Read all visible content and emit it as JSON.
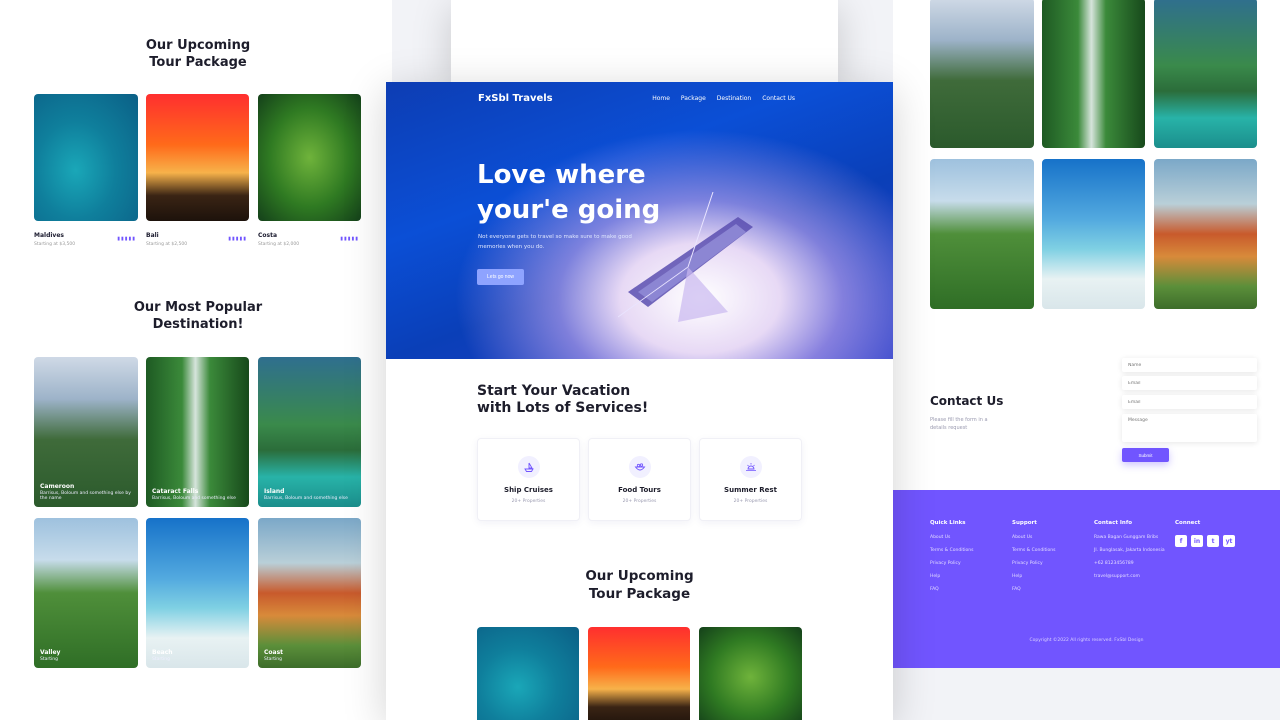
{
  "left": {
    "upcoming_title": "Our Upcoming Tour Package",
    "upcoming_cards": [
      {
        "name": "Maldives",
        "sub": "Starting at $3,500",
        "tag": "▮▮▮▮▮"
      },
      {
        "name": "Bali",
        "sub": "Starting at $2,500",
        "tag": "▮▮▮▮▮"
      },
      {
        "name": "Costa",
        "sub": "Starting at $2,000",
        "tag": "▮▮▮▮▮"
      }
    ],
    "popular_title": "Our Most Popular Destination!",
    "popular_cards": [
      {
        "title": "Cameroon",
        "text": "Barrisus, Boloum and something else by the name",
        "img": "temple"
      },
      {
        "title": "Cataract Falls",
        "text": "Barrisus, Boloum and something else",
        "img": "waterfall"
      },
      {
        "title": "Island",
        "text": "Barrisus, Boloum and something else",
        "img": "beachpalm"
      },
      {
        "title": "Valley",
        "text": "Starting",
        "img": "hills"
      },
      {
        "title": "Beach",
        "text": "Starting",
        "img": "umbrella"
      },
      {
        "title": "Coast",
        "text": "Starting",
        "img": "coast"
      }
    ]
  },
  "center": {
    "brand": "FxSbl Travels",
    "nav": [
      "Home",
      "Package",
      "Destination",
      "Contact Us"
    ],
    "hero_title_1": "Love where",
    "hero_title_2": "your'e going",
    "hero_sub": "Not everyone gets to travel so make sure to make good memories when you do.",
    "hero_button": "Lets go now",
    "services_title_1": "Start Your Vacation",
    "services_title_2": "with Lots of Services!",
    "services": [
      {
        "name": "Ship Cruises",
        "meta": "20+ Properties",
        "icon": "ship-icon"
      },
      {
        "name": "Food Tours",
        "meta": "20+ Properties",
        "icon": "food-icon"
      },
      {
        "name": "Summer Rest",
        "meta": "20+ Properties",
        "icon": "sun-icon"
      }
    ],
    "upcoming_title_1": "Our Upcoming",
    "upcoming_title_2": "Tour Package"
  },
  "right": {
    "contact_title": "Contact Us",
    "contact_sub": "Please fill the form in a details request",
    "fields": {
      "name": "Name",
      "email": "Email",
      "subject": "Email",
      "message": "Message"
    },
    "submit": "Submit",
    "footer": {
      "columns": [
        {
          "head": "Quick Links",
          "links": [
            "About Us",
            "Terms & Conditions",
            "Privacy Policy",
            "Help",
            "FAQ"
          ]
        },
        {
          "head": "Support",
          "links": [
            "About Us",
            "Terms & Conditions",
            "Privacy Policy",
            "Help",
            "FAQ"
          ]
        },
        {
          "head": "Contact Info",
          "links": [
            "Rawa Bagan Gunggam Bribs",
            "Jl. Bunglasak, Jakarta Indonesia",
            "+62 8123456789",
            "travel@support.com"
          ]
        },
        {
          "head": "Connect",
          "links": []
        }
      ],
      "social": [
        "f",
        "in",
        "t",
        "yt"
      ],
      "copyright": "Copyright ©2022 All rights reserved. FxSbl Design"
    }
  },
  "colors": {
    "accent": "#7155ff",
    "hero_blue": "#0b4fd6"
  }
}
